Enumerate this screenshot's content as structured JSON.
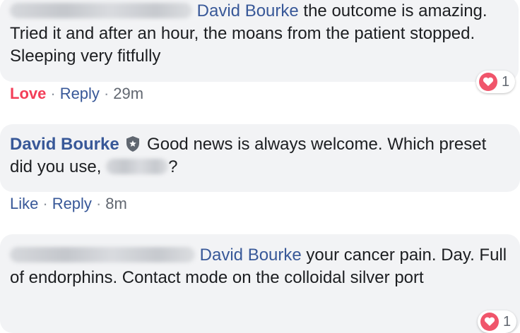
{
  "comments": [
    {
      "mention": "David Bourke",
      "text": " the outcome is amazing. Tried it and after an hour, the moans from the patient stopped. Sleeping very fitfully",
      "actions": {
        "reaction": "Love",
        "reply": "Reply",
        "time": "29m"
      },
      "reaction_count": "1"
    },
    {
      "author": "David Bourke",
      "text_before": " Good news is always welcome. Which preset did you use, ",
      "text_after": "?",
      "actions": {
        "like": "Like",
        "reply": "Reply",
        "time": "8m"
      }
    },
    {
      "mention": "David Bourke",
      "text": " your cancer pain. Day. Full of endorphins. Contact mode on the colloidal silver port",
      "reaction_count": "1"
    }
  ],
  "colors": {
    "link": "#385898",
    "bubble": "#f2f3f5",
    "love": "#f33e58",
    "meta": "#616770"
  },
  "icons": {
    "verified": "shield-icon",
    "reaction": "heart-icon"
  }
}
